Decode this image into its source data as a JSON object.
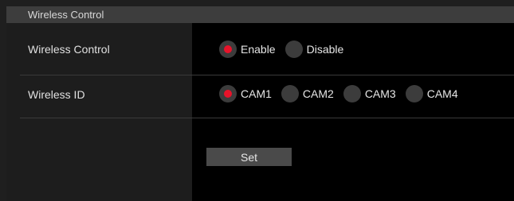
{
  "section": {
    "title": "Wireless Control"
  },
  "rows": [
    {
      "label": "Wireless Control",
      "options": [
        {
          "label": "Enable",
          "selected": true
        },
        {
          "label": "Disable",
          "selected": false
        }
      ]
    },
    {
      "label": "Wireless ID",
      "options": [
        {
          "label": "CAM1",
          "selected": true
        },
        {
          "label": "CAM2",
          "selected": false
        },
        {
          "label": "CAM3",
          "selected": false
        },
        {
          "label": "CAM4",
          "selected": false
        }
      ]
    }
  ],
  "actions": {
    "set_label": "Set"
  },
  "colors": {
    "accent": "#e8132a",
    "header_bg": "#3d3d3d",
    "value_bg": "#000000",
    "button_bg": "#4a4a4a"
  }
}
